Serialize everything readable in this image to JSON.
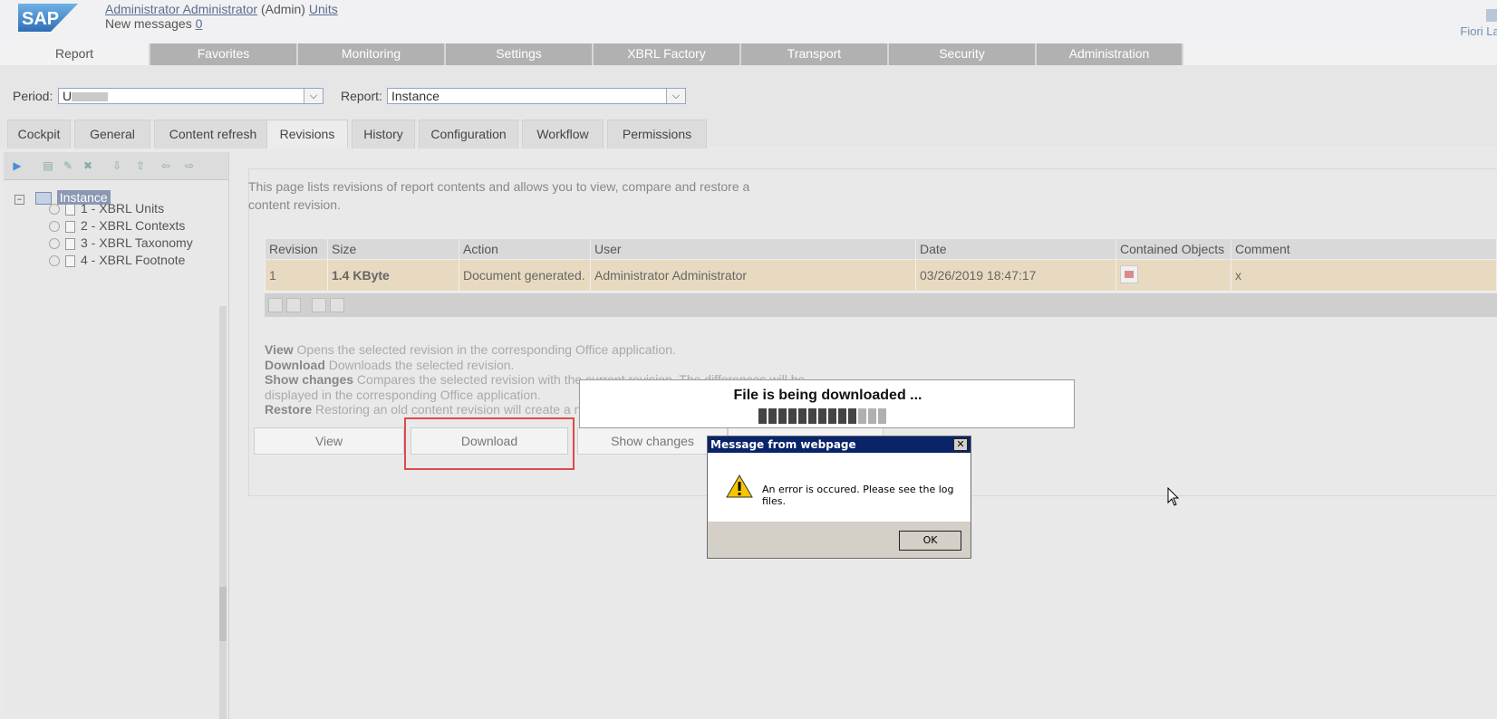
{
  "header": {
    "logo_text": "SAP",
    "user_name": "Administrator Administrator",
    "user_role": "(Admin)",
    "units_link": "Units",
    "messages_label": "New messages",
    "messages_count": "0",
    "fiori_label": "Fiori Lau"
  },
  "main_tabs": [
    "Report",
    "Favorites",
    "Monitoring",
    "Settings",
    "XBRL Factory",
    "Transport",
    "Security",
    "Administration"
  ],
  "filters": {
    "period_label": "Period:",
    "period_value": "U",
    "report_label": "Report:",
    "report_value": "Instance"
  },
  "sub_tabs": [
    "Cockpit",
    "General",
    "Content refresh",
    "Revisions",
    "History",
    "Configuration",
    "Workflow",
    "Permissions"
  ],
  "tree": {
    "root": "Instance",
    "items": [
      "1 - XBRL Units",
      "2 - XBRL Contexts",
      "3 - XBRL Taxonomy",
      "4 - XBRL Footnote"
    ]
  },
  "content": {
    "intro": "This page lists revisions of report contents and allows you to view, compare and restore a content revision.",
    "table": {
      "headers": [
        "Revision",
        "Size",
        "Action",
        "User",
        "Date",
        "Contained Objects",
        "Comment"
      ],
      "rows": [
        {
          "revision": "1",
          "size": "1.4 KByte",
          "action": "Document generated.",
          "user": "Administrator Administrator",
          "date": "03/26/2019 18:47:17",
          "comment": "x"
        }
      ]
    },
    "help": {
      "view_term": "View",
      "view_desc": " Opens the selected revision in the corresponding Office application.",
      "download_term": "Download",
      "download_desc": " Downloads the selected revision.",
      "show_term": "Show changes",
      "show_desc": " Compares the selected revision with the current revision. The differences will be displayed in the corresponding Office application.",
      "restore_term": "Restore",
      "restore_desc": " Restoring an old content revision will create a ne"
    },
    "buttons": {
      "view": "View",
      "download": "Download",
      "show_changes": "Show changes"
    }
  },
  "download_overlay": {
    "title": "File is being downloaded ..."
  },
  "message_dialog": {
    "title": "Message from webpage",
    "text": "An error is occured. Please see the log files.",
    "ok": "OK"
  }
}
